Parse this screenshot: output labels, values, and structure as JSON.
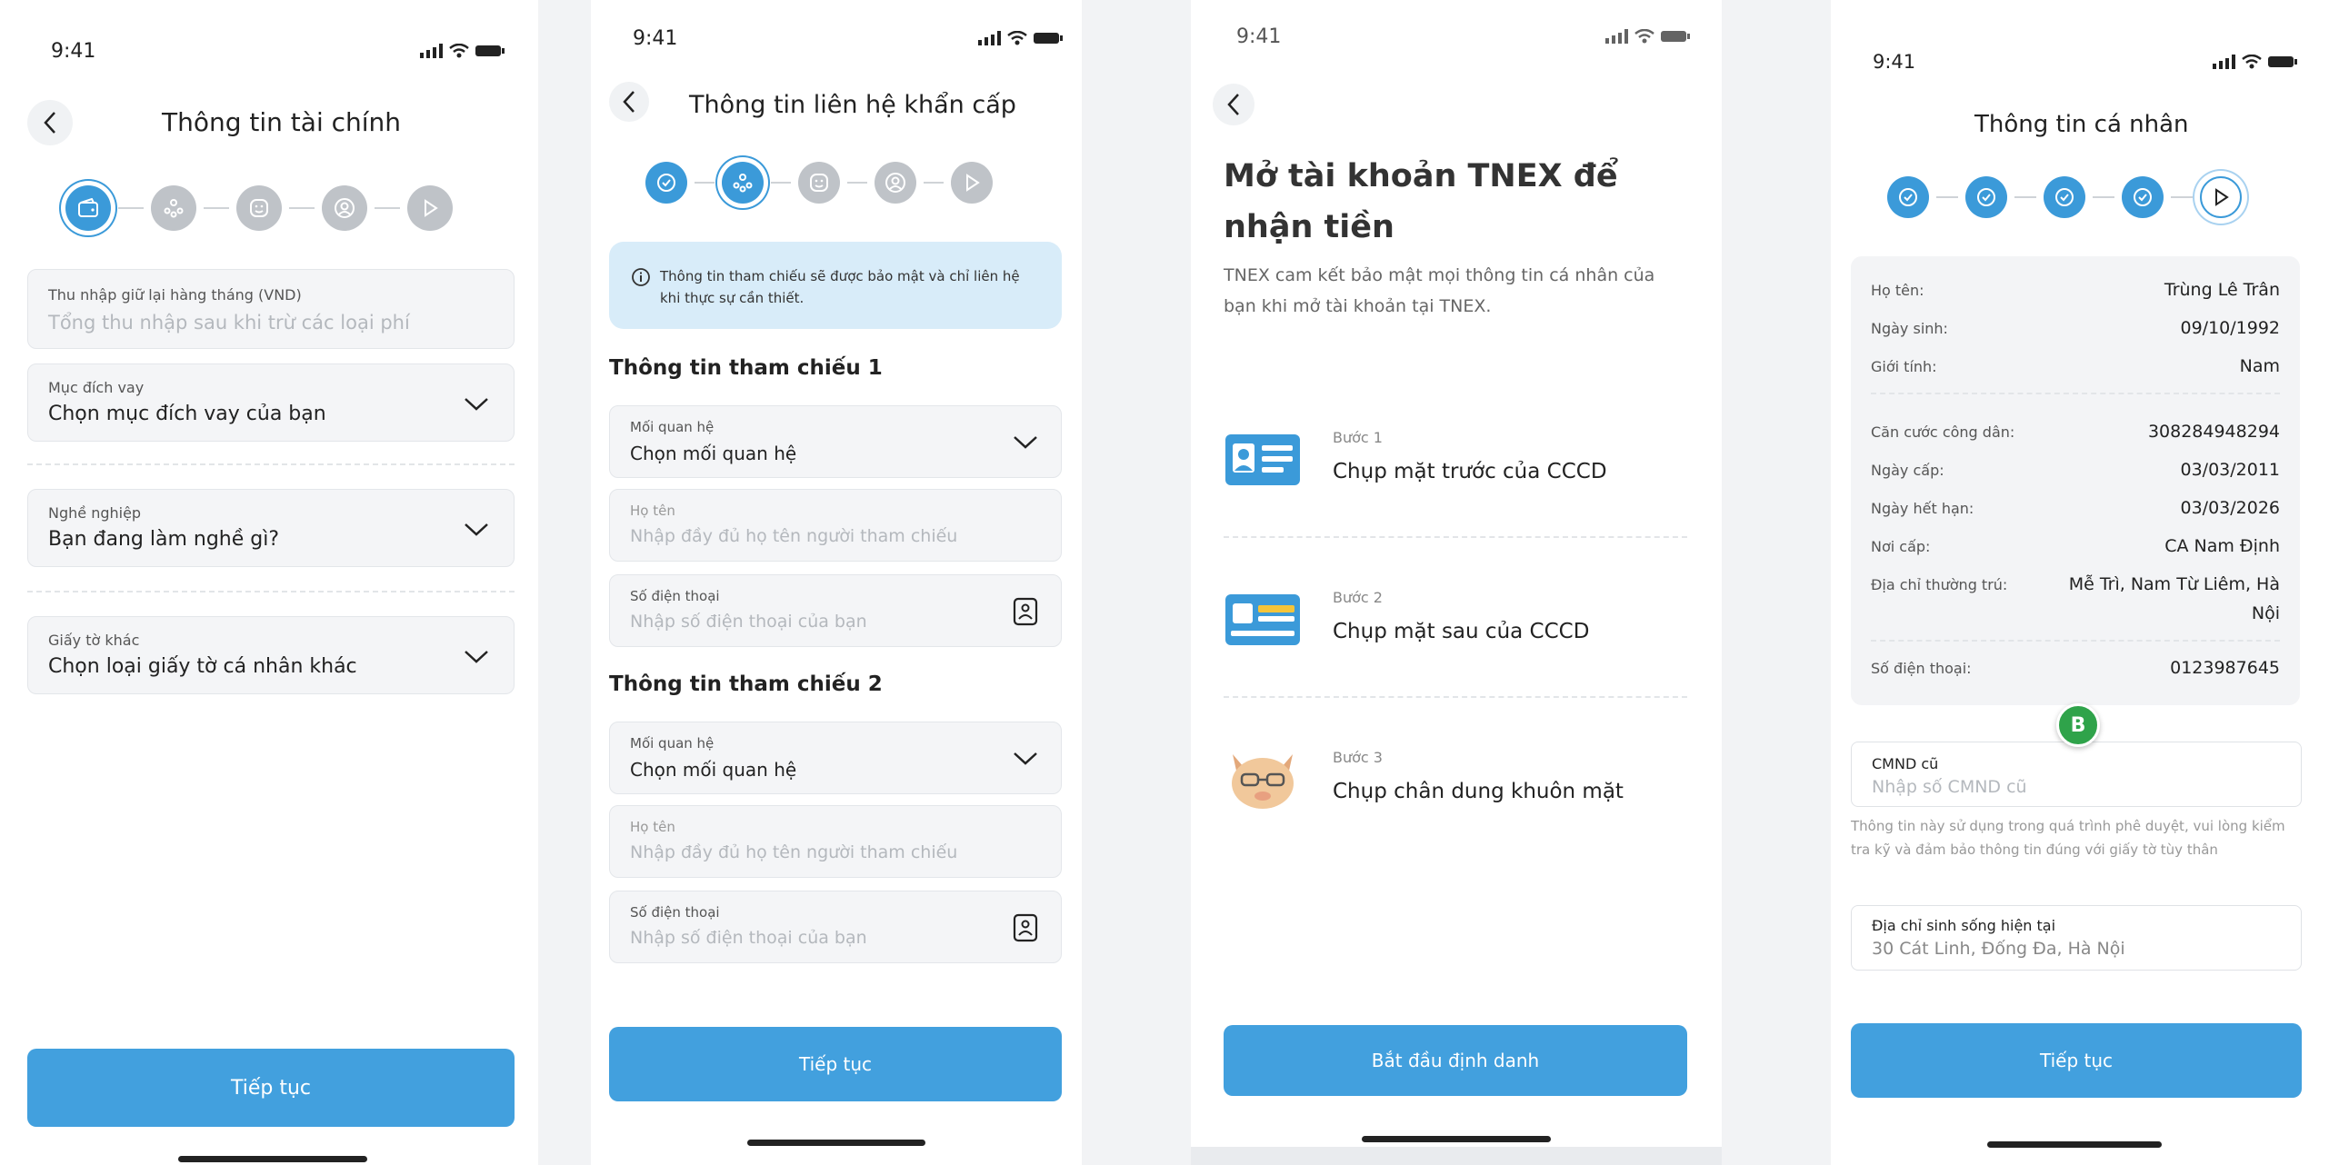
{
  "status_time": "9:41",
  "screen1": {
    "title": "Thông tin tài chính",
    "fields": [
      {
        "label": "Thu nhập giữ lại hàng tháng (VND)",
        "placeholder": "Tổng thu nhập sau khi trừ các loại phí"
      },
      {
        "label": "Mục đích vay",
        "value": "Chọn mục đích vay của bạn"
      },
      {
        "label": "Nghề nghiệp",
        "value": "Bạn đang làm nghề gì?"
      },
      {
        "label": "Giấy tờ khác",
        "value": "Chọn loại giấy tờ cá nhân khác"
      }
    ],
    "button": "Tiếp tục"
  },
  "screen2": {
    "title": "Thông tin liên hệ khẩn cấp",
    "notice": "Thông tin tham chiếu sẽ được bảo mật và chỉ liên hệ khi thực sự cần thiết.",
    "ref1": {
      "heading": "Thông tin tham chiếu 1",
      "relation_label": "Mối quan hệ",
      "relation_value": "Chọn mối quan hệ",
      "name_label": "Họ tên",
      "name_placeholder": "Nhập đầy đủ họ tên người tham chiếu",
      "phone_label": "Số điện thoại",
      "phone_placeholder": "Nhập số điện thoại của bạn"
    },
    "ref2": {
      "heading": "Thông tin tham chiếu 2",
      "relation_label": "Mối quan hệ",
      "relation_value": "Chọn mối quan hệ",
      "name_label": "Họ tên",
      "name_placeholder": "Nhập đầy đủ họ tên người tham chiếu",
      "phone_label": "Số điện thoại",
      "phone_placeholder": "Nhập số điện thoại của bạn"
    },
    "button": "Tiếp tục"
  },
  "screen3": {
    "headline": "Mở tài khoản TNEX để nhận tiền",
    "subtitle": "TNEX cam kết bảo mật mọi thông tin cá nhân của bạn khi mở tài khoản tại TNEX.",
    "steps": [
      {
        "label": "Bước 1",
        "title": "Chụp mặt trước của CCCD"
      },
      {
        "label": "Bước 2",
        "title": "Chụp mặt sau của CCCD"
      },
      {
        "label": "Bước 3",
        "title": "Chụp chân dung khuôn mặt"
      }
    ],
    "button": "Bắt đầu định danh"
  },
  "screen4": {
    "title": "Thông tin cá nhân",
    "rows_a": [
      {
        "label": "Họ tên:",
        "value": "Trùng Lê Trân"
      },
      {
        "label": "Ngày sinh:",
        "value": "09/10/1992"
      },
      {
        "label": "Giới tính:",
        "value": "Nam"
      }
    ],
    "rows_b": [
      {
        "label": "Căn cước công dân:",
        "value": "308284948294"
      },
      {
        "label": "Ngày cấp:",
        "value": "03/03/2011"
      },
      {
        "label": "Ngày hết hạn:",
        "value": "03/03/2026"
      },
      {
        "label": "Nơi cấp:",
        "value": "CA Nam Định"
      },
      {
        "label": "Địa chỉ thường trú:",
        "value_line1": "Mễ Trì, Nam Từ Liêm, Hà",
        "value_line2": "Nội"
      }
    ],
    "rows_c": [
      {
        "label": "Số điện thoại:",
        "value": "0123987645"
      }
    ],
    "badge": "B",
    "cmnd_label": "CMND cũ",
    "cmnd_placeholder": "Nhập số CMND cũ",
    "hint": "Thông tin này sử dụng trong quá trình phê duyệt, vui lòng kiểm tra kỹ và đảm bảo thông tin đúng với giấy tờ tùy thân",
    "address_label": "Địa chỉ sinh sống hiện tại",
    "address_value": "30 Cát Linh, Đống Đa, Hà Nội",
    "button": "Tiếp tục"
  },
  "colors": {
    "primary": "#42a0de",
    "notice_bg": "#d8ecf9",
    "inactive_step": "#bfc3c8"
  },
  "icons": [
    "back-arrow-icon",
    "wallet-icon",
    "people-icon",
    "face-scan-icon",
    "user-circle-icon",
    "play-icon",
    "check-icon",
    "info-icon",
    "contact-book-icon",
    "chevron-down-icon",
    "id-card-front-icon",
    "id-card-back-icon",
    "face-portrait-icon",
    "signal-icon",
    "wifi-icon",
    "battery-icon"
  ]
}
